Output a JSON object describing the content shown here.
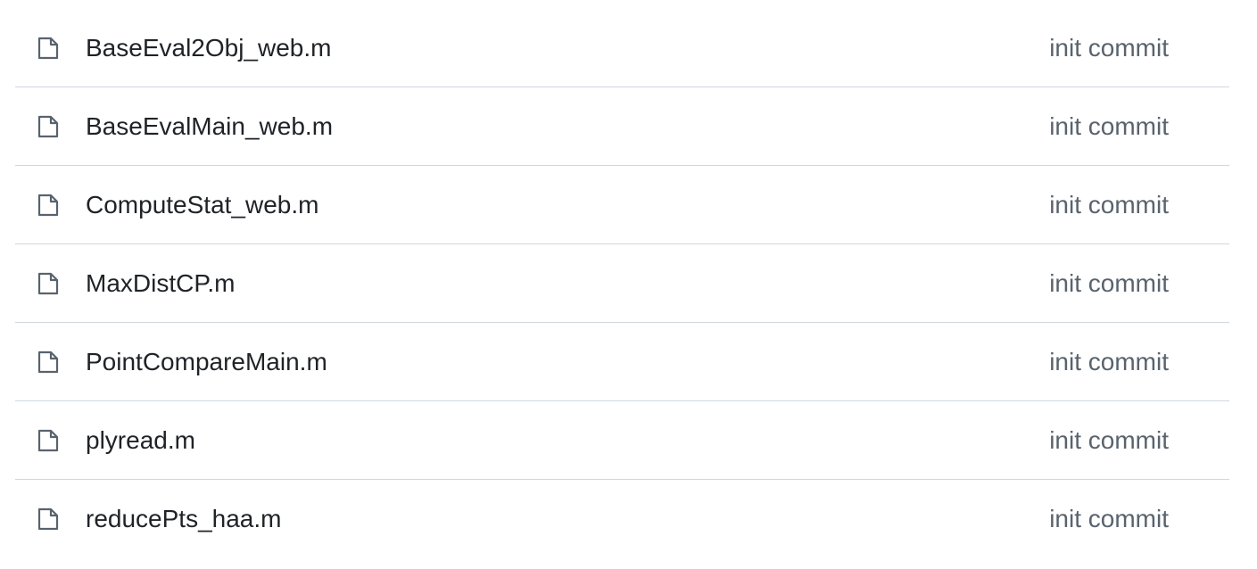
{
  "files": [
    {
      "icon": "file-icon",
      "name": "BaseEval2Obj_web.m",
      "commit": "init commit"
    },
    {
      "icon": "file-icon",
      "name": "BaseEvalMain_web.m",
      "commit": "init commit"
    },
    {
      "icon": "file-icon",
      "name": "ComputeStat_web.m",
      "commit": "init commit"
    },
    {
      "icon": "file-icon",
      "name": "MaxDistCP.m",
      "commit": "init commit"
    },
    {
      "icon": "file-icon",
      "name": "PointCompareMain.m",
      "commit": "init commit"
    },
    {
      "icon": "file-icon",
      "name": "plyread.m",
      "commit": "init commit"
    },
    {
      "icon": "file-icon",
      "name": "reducePts_haa.m",
      "commit": "init commit"
    }
  ],
  "colors": {
    "text": "#1f2328",
    "muted": "#59636e",
    "icon": "#59636e",
    "divider": "#d0d7de"
  }
}
